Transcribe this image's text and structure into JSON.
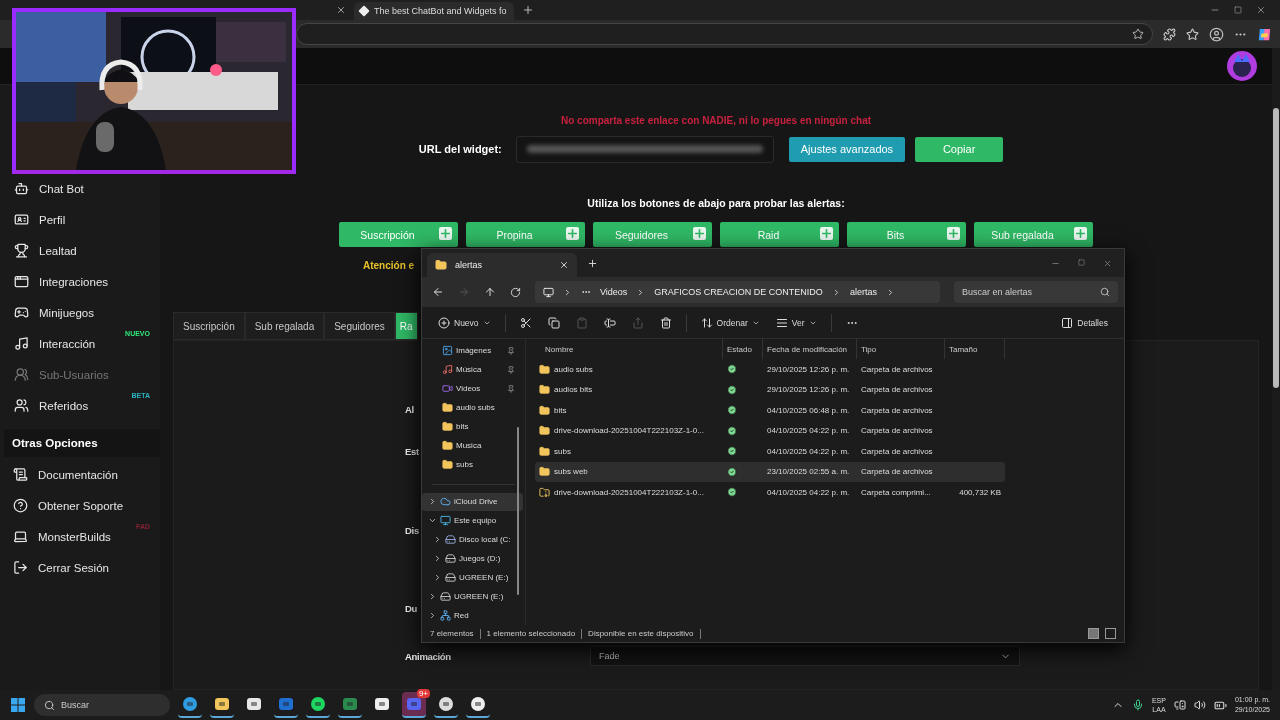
{
  "browser": {
    "tabs": [
      {
        "title": "The best ChatBot and Widgets fo",
        "selected": true
      }
    ]
  },
  "sidebar": {
    "items": [
      {
        "label": "Chat Bot",
        "kind": "bot",
        "disabled": false
      },
      {
        "label": "Perfil",
        "kind": "profile",
        "disabled": false
      },
      {
        "label": "Lealtad",
        "kind": "trophy",
        "disabled": false
      },
      {
        "label": "Integraciones",
        "kind": "integrations",
        "disabled": false
      },
      {
        "label": "Minijuegos",
        "kind": "games",
        "disabled": false
      },
      {
        "label": "Interacción",
        "kind": "music",
        "disabled": false,
        "badge": {
          "text": "NUEVO",
          "color": "#2ee87a"
        }
      },
      {
        "label": "Sub-Usuarios",
        "kind": "team",
        "disabled": true
      },
      {
        "label": "Referidos",
        "kind": "users",
        "disabled": false,
        "badge": {
          "text": "BETA",
          "color": "#2bb3c0"
        }
      }
    ],
    "section": "Otras Opciones",
    "other_items": [
      {
        "label": "Documentación",
        "kind": "docs",
        "disabled": false
      },
      {
        "label": "Obtener Soporte",
        "kind": "help",
        "disabled": false
      },
      {
        "label": "MonsterBuilds",
        "kind": "laptop",
        "disabled": false,
        "badge": {
          "text": "FAD",
          "color": "#8a1f35"
        }
      },
      {
        "label": "Cerrar Sesión",
        "kind": "logout",
        "disabled": false
      }
    ]
  },
  "page": {
    "warning": "No comparta este enlace con NADIE, ni lo pegues en ningún chat",
    "url_label": "URL del widget:",
    "url_buttons": [
      {
        "label": "Ajustes avanzados",
        "kind": "info"
      },
      {
        "label": "Copiar",
        "kind": "success"
      }
    ],
    "test_prompt": "Utiliza los botones de abajo para probar las alertas:",
    "test_buttons": [
      "Suscripción",
      "Propina",
      "Seguidores",
      "Raid",
      "Bits",
      "Sub regalada"
    ],
    "attention": "Atención e",
    "alert_tabs": [
      {
        "label": "Suscripción",
        "selected": false
      },
      {
        "label": "Sub regalada",
        "selected": false
      },
      {
        "label": "Seguidores",
        "selected": false
      },
      {
        "label": "Ra",
        "selected": true
      }
    ],
    "field_labels": [
      "Al",
      "Est",
      "Dis",
      "Du",
      "Animación"
    ],
    "animation_select": {
      "value": "Fade"
    }
  },
  "explorer": {
    "tab": "alertas",
    "nav": {
      "forward_disabled": true
    },
    "breadcrumb": [
      "Videos",
      "GRAFICOS CREACION DE CONTENIDO",
      "alertas"
    ],
    "search": {
      "placeholder": "Buscar en alertas"
    },
    "toolbar": [
      {
        "kind": "new",
        "label": "Nuevo",
        "disabled": false
      },
      {
        "kind": "cut",
        "disabled": false
      },
      {
        "kind": "copy",
        "disabled": false
      },
      {
        "kind": "paste",
        "disabled": true
      },
      {
        "kind": "rename",
        "disabled": false
      },
      {
        "kind": "share",
        "disabled": true
      },
      {
        "kind": "delete",
        "disabled": false
      },
      {
        "kind": "sort",
        "label": "Ordenar",
        "disabled": false
      },
      {
        "kind": "view",
        "label": "Ver",
        "disabled": false
      },
      {
        "kind": "more",
        "disabled": false
      }
    ],
    "details": "Detalles",
    "quick_access": [
      {
        "label": "Imágenes",
        "kind": "images",
        "pinned": true
      },
      {
        "label": "Música",
        "kind": "music",
        "pinned": true
      },
      {
        "label": "Videos",
        "kind": "videos",
        "pinned": true
      },
      {
        "label": "audio subs",
        "kind": "folder",
        "pinned": false
      },
      {
        "label": "bits",
        "kind": "folder",
        "pinned": false
      },
      {
        "label": "Musica",
        "kind": "folder",
        "pinned": false
      },
      {
        "label": "subs",
        "kind": "folder",
        "pinned": false
      }
    ],
    "tree": [
      {
        "label": "iCloud Drive",
        "kind": "cloud",
        "expanded": false,
        "selected": true
      },
      {
        "label": "Este equipo",
        "kind": "pc",
        "expanded": true,
        "selected": false,
        "children": [
          {
            "label": "Disco local (C:",
            "kind": "disk",
            "expanded": false,
            "selected": false
          },
          {
            "label": "Juegos (D:)",
            "kind": "drive",
            "expanded": false,
            "selected": false
          },
          {
            "label": "UGREEN (E:)",
            "kind": "drive",
            "expanded": false,
            "selected": false
          }
        ]
      },
      {
        "label": "UGREEN (E:)",
        "kind": "drive",
        "expanded": false,
        "selected": false
      },
      {
        "label": "Red",
        "kind": "network",
        "expanded": false,
        "selected": false
      }
    ],
    "columns": [
      "Nombre",
      "Estado",
      "Fecha de modificación",
      "Tipo",
      "Tamaño"
    ],
    "rows": [
      {
        "name": "audio subs",
        "kind": "folder",
        "modified": "29/10/2025 12:26 p. m.",
        "type": "Carpeta de archivos",
        "selected": false
      },
      {
        "name": "audios bits",
        "kind": "folder",
        "modified": "29/10/2025 12:26 p. m.",
        "type": "Carpeta de archivos",
        "selected": false
      },
      {
        "name": "bits",
        "kind": "folder",
        "modified": "04/10/2025 06:48 p. m.",
        "type": "Carpeta de archivos",
        "selected": false
      },
      {
        "name": "drive-download-20251004T222103Z-1-0...",
        "kind": "folder",
        "modified": "04/10/2025 04:22 p. m.",
        "type": "Carpeta de archivos",
        "selected": false
      },
      {
        "name": "subs",
        "kind": "folder",
        "modified": "04/10/2025 04:22 p. m.",
        "type": "Carpeta de archivos",
        "selected": false
      },
      {
        "name": "subs web",
        "kind": "folder",
        "modified": "23/10/2025 02:55 a. m.",
        "type": "Carpeta de archivos",
        "selected": true
      },
      {
        "name": "drive-download-20251004T222103Z-1-0...",
        "kind": "zip",
        "modified": "04/10/2025 04:22 p. m.",
        "type": "Carpeta comprimi...",
        "size": "400,732 KB",
        "selected": false
      }
    ],
    "status": [
      "7 elementos",
      "1 elemento seleccionado",
      "Disponible en este dispositivo"
    ]
  },
  "taskbar": {
    "search": {
      "placeholder": "Buscar"
    },
    "apps": [
      {
        "kind": "browser",
        "running": true,
        "selected": false
      },
      {
        "kind": "files",
        "running": true,
        "selected": false
      },
      {
        "kind": "store",
        "running": false,
        "selected": false
      },
      {
        "kind": "mail",
        "running": true,
        "selected": false
      },
      {
        "kind": "spotify",
        "running": true,
        "selected": false
      },
      {
        "kind": "sheet",
        "running": true,
        "selected": false
      },
      {
        "kind": "wave",
        "running": false,
        "selected": false
      },
      {
        "kind": "chat",
        "running": true,
        "selected": true,
        "badge": "9+"
      },
      {
        "kind": "record",
        "running": true,
        "selected": false
      },
      {
        "kind": "player",
        "running": true,
        "selected": false
      }
    ],
    "language": [
      "ESP",
      "LAA"
    ],
    "time": "01:00 p. m.",
    "date": "29/10/2025"
  }
}
